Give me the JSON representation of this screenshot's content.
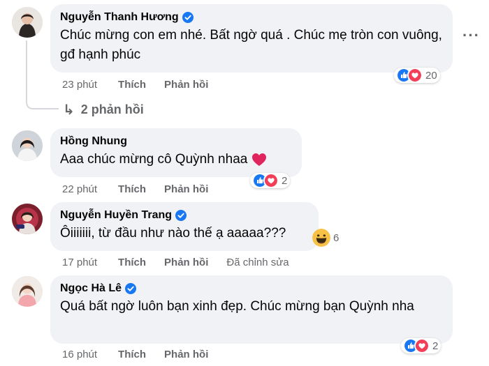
{
  "colors": {
    "bubble": "#f0f2f5",
    "meta": "#65676b",
    "verified": "#1877f2",
    "like": "#1877f2",
    "love": "#f33e58"
  },
  "comments": [
    {
      "author": "Nguyễn Thanh Hương",
      "verified": true,
      "text": "Chúc mừng con em nhé. Bất ngờ quá . Chúc mẹ tròn con vuông, gđ hạnh phúc",
      "time": "23 phút",
      "like_label": "Thích",
      "reply_label": "Phản hồi",
      "reactions": [
        "like-icon",
        "love-icon"
      ],
      "reaction_count": "20",
      "replies_label": "2 phản hồi"
    },
    {
      "author": "Hồng Nhung",
      "verified": false,
      "text": "Aaa chúc mừng cô Quỳnh nhaa",
      "emoji": "red-heart-icon",
      "time": "22 phút",
      "like_label": "Thích",
      "reply_label": "Phản hồi",
      "reactions": [
        "like-icon",
        "love-icon"
      ],
      "reaction_count": "2"
    },
    {
      "author": "Nguyễn Huyền Trang",
      "verified": true,
      "text": "Ôiiiiiii, từ đầu như nào thế ạ aaaaa???",
      "time": "17 phút",
      "like_label": "Thích",
      "reply_label": "Phản hồi",
      "edited_label": "Đã chỉnh sửa",
      "reactions": [
        "haha-icon"
      ],
      "reaction_count": "6"
    },
    {
      "author": "Ngọc Hà Lê",
      "verified": true,
      "text": "Quá bất ngờ luôn bạn xinh đẹp. Chúc mừng bạn Quỳnh nha",
      "time": "16 phút",
      "like_label": "Thích",
      "reply_label": "Phản hồi",
      "reactions": [
        "like-icon",
        "love-icon"
      ],
      "reaction_count": "2"
    }
  ]
}
